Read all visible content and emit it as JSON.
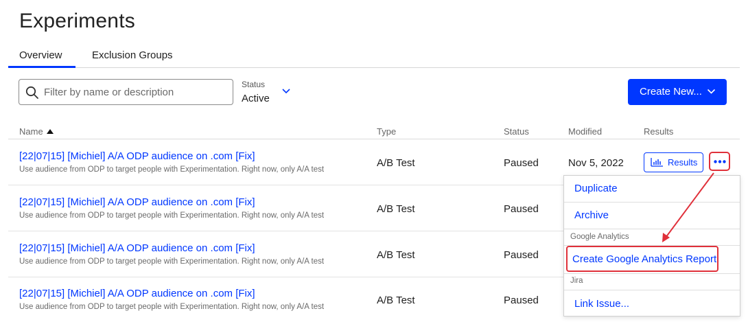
{
  "page": {
    "title": "Experiments"
  },
  "tabs": [
    {
      "label": "Overview",
      "active": true
    },
    {
      "label": "Exclusion Groups",
      "active": false
    }
  ],
  "filter": {
    "placeholder": "Filter by name or description",
    "value": ""
  },
  "status_filter": {
    "caption": "Status",
    "value": "Active"
  },
  "create_button": {
    "label": "Create New..."
  },
  "table": {
    "columns": {
      "name": "Name",
      "type": "Type",
      "status": "Status",
      "modified": "Modified",
      "results": "Results"
    },
    "rows": [
      {
        "title": "[22|07|15] [Michiel] A/A ODP audience on .com [Fix]",
        "description": "Use audience from ODP to target people with Experimentation. Right now, only A/A test",
        "type": "A/B Test",
        "status": "Paused",
        "modified": "Nov 5, 2022"
      },
      {
        "title": "[22|07|15] [Michiel] A/A ODP audience on .com [Fix]",
        "description": "Use audience from ODP to target people with Experimentation. Right now, only A/A test",
        "type": "A/B Test",
        "status": "Paused",
        "modified": ""
      },
      {
        "title": "[22|07|15] [Michiel] A/A ODP audience on .com [Fix]",
        "description": "Use audience from ODP to target people with Experimentation. Right now, only A/A test",
        "type": "A/B Test",
        "status": "Paused",
        "modified": ""
      },
      {
        "title": "[22|07|15] [Michiel] A/A ODP audience on .com [Fix]",
        "description": "Use audience from ODP to target people with Experimentation. Right now, only A/A test",
        "type": "A/B Test",
        "status": "Paused",
        "modified": ""
      }
    ]
  },
  "results_button": {
    "label": "Results"
  },
  "menu": {
    "duplicate": "Duplicate",
    "archive": "Archive",
    "ga_group": "Google Analytics",
    "ga_report": "Create Google Analytics Report",
    "jira_group": "Jira",
    "link_issue": "Link Issue..."
  },
  "icons": {
    "search": "search-icon",
    "chevron": "chevron-down-icon",
    "sort": "sort-ascending-icon",
    "results": "bar-chart-icon",
    "more": "more-horizontal-icon"
  },
  "colors": {
    "accent": "#0037ff",
    "highlight": "#e0303a"
  }
}
